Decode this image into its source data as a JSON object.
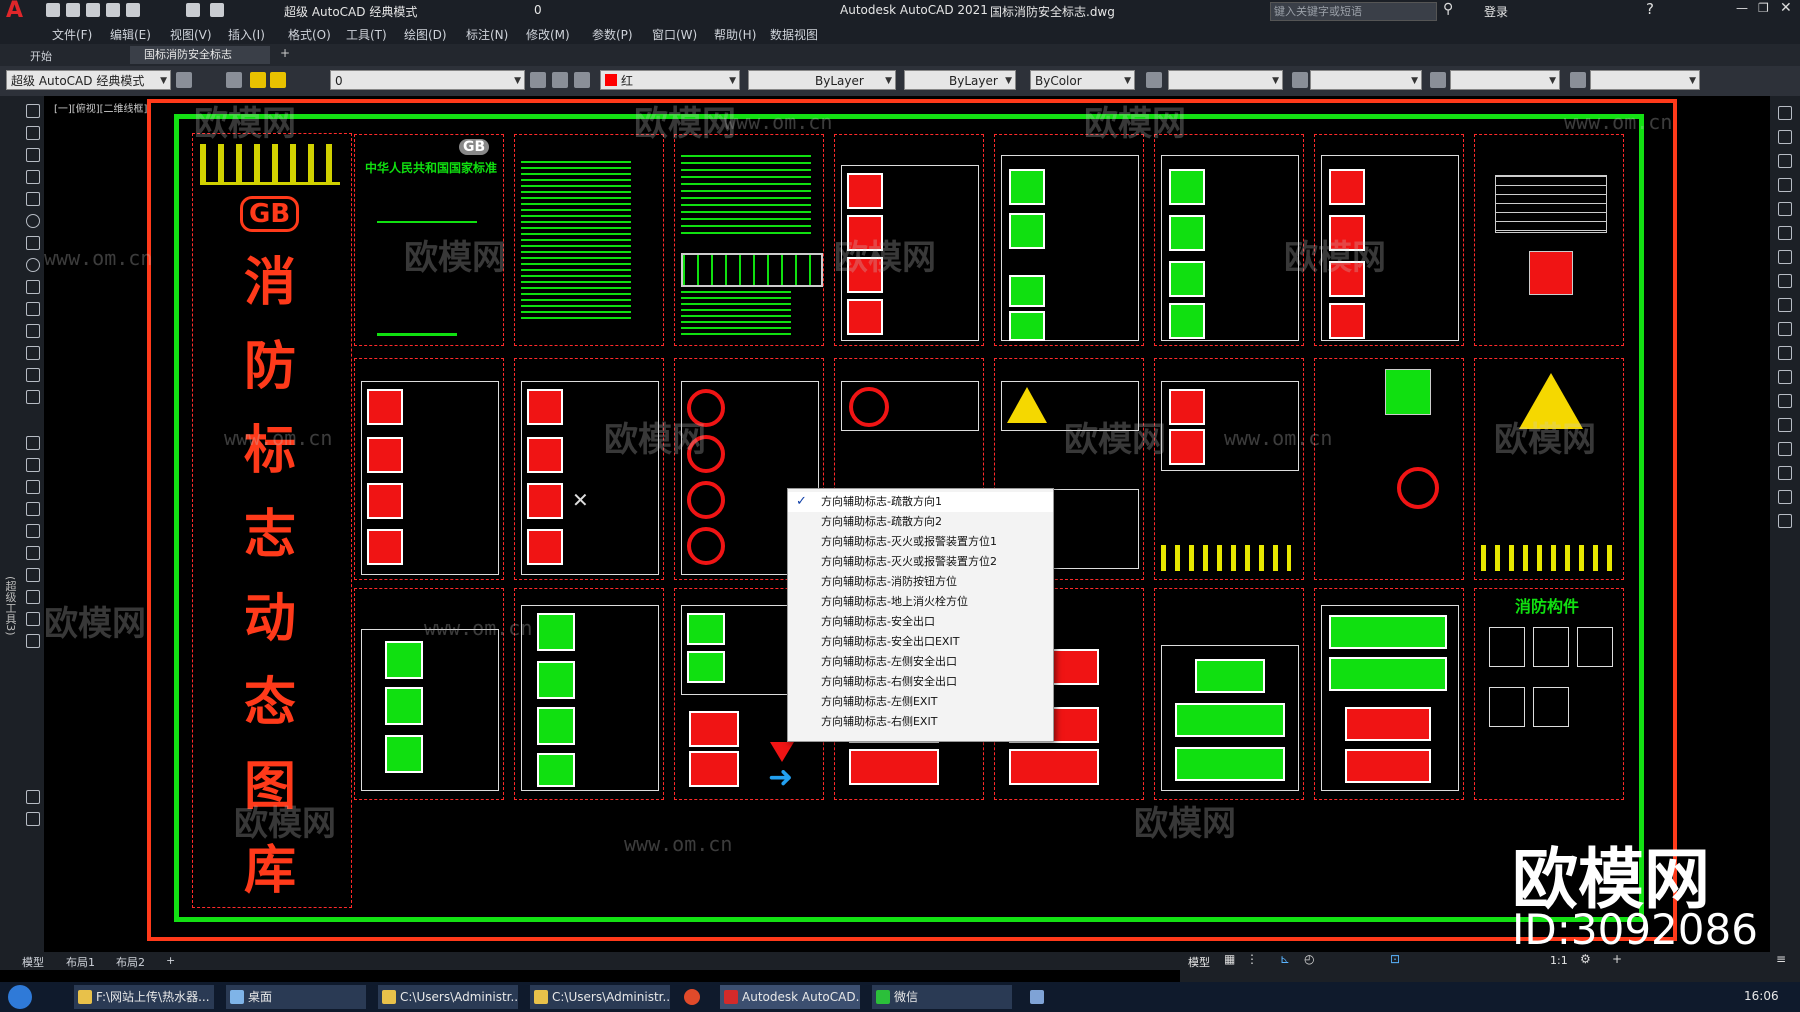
{
  "app": {
    "title": "Autodesk AutoCAD 2021",
    "filename": "国标消防安全标志.dwg",
    "workspace": "超级 AutoCAD 经典模式",
    "layer_value": "0",
    "search_placeholder": "键入关键字或短语",
    "login": "登录"
  },
  "menu": [
    "文件(F)",
    "编辑(E)",
    "视图(V)",
    "插入(I)",
    "格式(O)",
    "工具(T)",
    "绘图(D)",
    "标注(N)",
    "修改(M)",
    "参数(P)",
    "窗口(W)",
    "帮助(H)",
    "数据视图"
  ],
  "tabs": {
    "start": "开始",
    "doc": "国标消防安全标志"
  },
  "toolbar": {
    "workspace": "超级 AutoCAD 经典模式",
    "layer": "0",
    "color": "红",
    "linetype": "ByLayer",
    "lineweight": "ByLayer",
    "plotstyle": "ByColor"
  },
  "viewport_label": "[一][俯视][二维线框]",
  "side_label": "(超级工具3)",
  "drawing": {
    "title_chars": [
      "消",
      "防",
      "标",
      "志",
      "动",
      "态",
      "图",
      "库"
    ],
    "gb_logo": "GB",
    "doc_heading": "中华人民共和国国家标准",
    "components_title": "消防构件"
  },
  "popup": {
    "items": [
      "方向辅助标志-疏散方向1",
      "方向辅助标志-疏散方向2",
      "方向辅助标志-灭火或报警装置方位1",
      "方向辅助标志-灭火或报警装置方位2",
      "方向辅助标志-消防按钮方位",
      "方向辅助标志-地上消火栓方位",
      "方向辅助标志-安全出口",
      "方向辅助标志-安全出口EXIT",
      "方向辅助标志-左侧安全出口",
      "方向辅助标志-右侧安全出口",
      "方向辅助标志-左侧EXIT",
      "方向辅助标志-右侧EXIT"
    ],
    "checked_index": 0
  },
  "layouts": [
    "模型",
    "布局1",
    "布局2"
  ],
  "status": {
    "model": "模型",
    "scale": "1:1"
  },
  "taskbar": {
    "items": [
      "F:\\网站上传\\热水器...",
      "桌面",
      "C:\\Users\\Administr...",
      "C:\\Users\\Administr...",
      "",
      "Autodesk AutoCAD...",
      "微信"
    ],
    "time": "16:06"
  },
  "watermark": {
    "brand": "欧模网",
    "url": "www.om.cn",
    "id": "ID:3092086"
  },
  "colors": {
    "frame": "#ff3a1a",
    "inner_frame": "#13e013",
    "sign_red": "#f01414",
    "sign_green": "#10e010"
  }
}
